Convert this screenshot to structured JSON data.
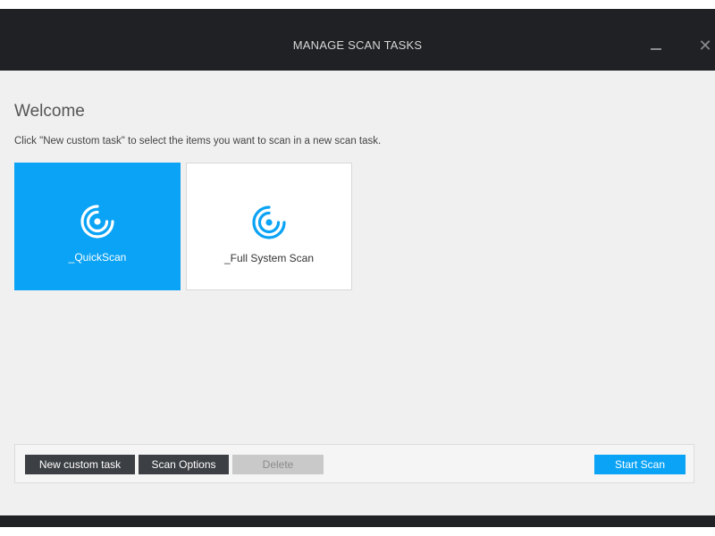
{
  "window": {
    "title": "MANAGE SCAN TASKS",
    "minimize_icon": "minimize-icon",
    "close_icon": "close-icon",
    "close_glyph": "✕"
  },
  "main": {
    "heading": "Welcome",
    "hint": "Click \"New custom task\" to select the items you want to scan in a new scan task."
  },
  "tasks": [
    {
      "label": "_QuickScan",
      "icon": "scan-icon",
      "selected": true
    },
    {
      "label": "_Full System Scan",
      "icon": "scan-icon",
      "selected": false
    }
  ],
  "toolbar": {
    "new_task_label": "New custom task",
    "scan_options_label": "Scan Options",
    "delete_label": "Delete",
    "start_scan_label": "Start Scan"
  },
  "colors": {
    "accent": "#0aa3f5",
    "titlebar": "#1f2124",
    "dark_button": "#3c3f43",
    "disabled_button": "#c9c9c9"
  }
}
